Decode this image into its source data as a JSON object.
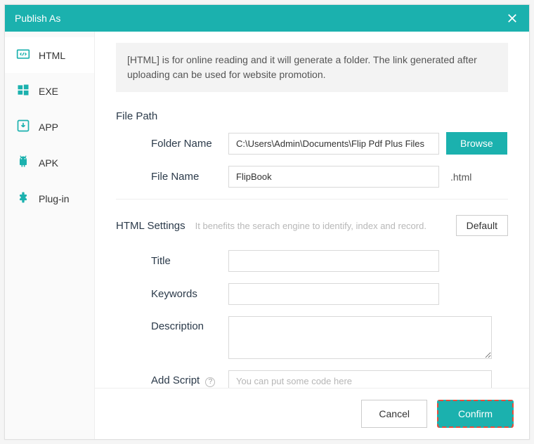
{
  "window": {
    "title": "Publish As"
  },
  "sidebar": {
    "items": [
      {
        "label": "HTML"
      },
      {
        "label": "EXE"
      },
      {
        "label": "APP"
      },
      {
        "label": "APK"
      },
      {
        "label": "Plug-in"
      }
    ]
  },
  "info": "[HTML] is for online reading and it will generate a folder. The link generated after uploading can be used for website promotion.",
  "filePath": {
    "heading": "File Path",
    "folderLabel": "Folder Name",
    "folderValue": "C:\\Users\\Admin\\Documents\\Flip Pdf Plus Files",
    "browse": "Browse",
    "fileLabel": "File Name",
    "fileValue": "FlipBook",
    "ext": ".html"
  },
  "htmlSettings": {
    "heading": "HTML Settings",
    "hint": "It benefits the serach engine to identify, index and record.",
    "defaultBtn": "Default",
    "titleLabel": "Title",
    "titleValue": "",
    "keywordsLabel": "Keywords",
    "keywordsValue": "",
    "descLabel": "Description",
    "descValue": "",
    "scriptLabel": "Add Script",
    "scriptPlaceholder": "You can put some code here",
    "scriptValue": ""
  },
  "footer": {
    "cancel": "Cancel",
    "confirm": "Confirm"
  }
}
